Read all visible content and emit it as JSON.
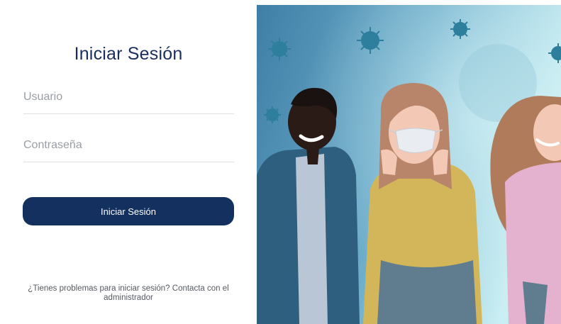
{
  "login": {
    "title": "Iniciar Sesión",
    "username_placeholder": "Usuario",
    "password_placeholder": "Contraseña",
    "submit_label": "Iniciar Sesión",
    "help_text": "¿Tienes problemas para iniciar sesión? Contacta con el administrador"
  },
  "colors": {
    "primary": "#14305f",
    "title": "#1b2f5c",
    "background": "#ffffff"
  },
  "illustration": {
    "subject": "people-with-virus-background-icon"
  }
}
